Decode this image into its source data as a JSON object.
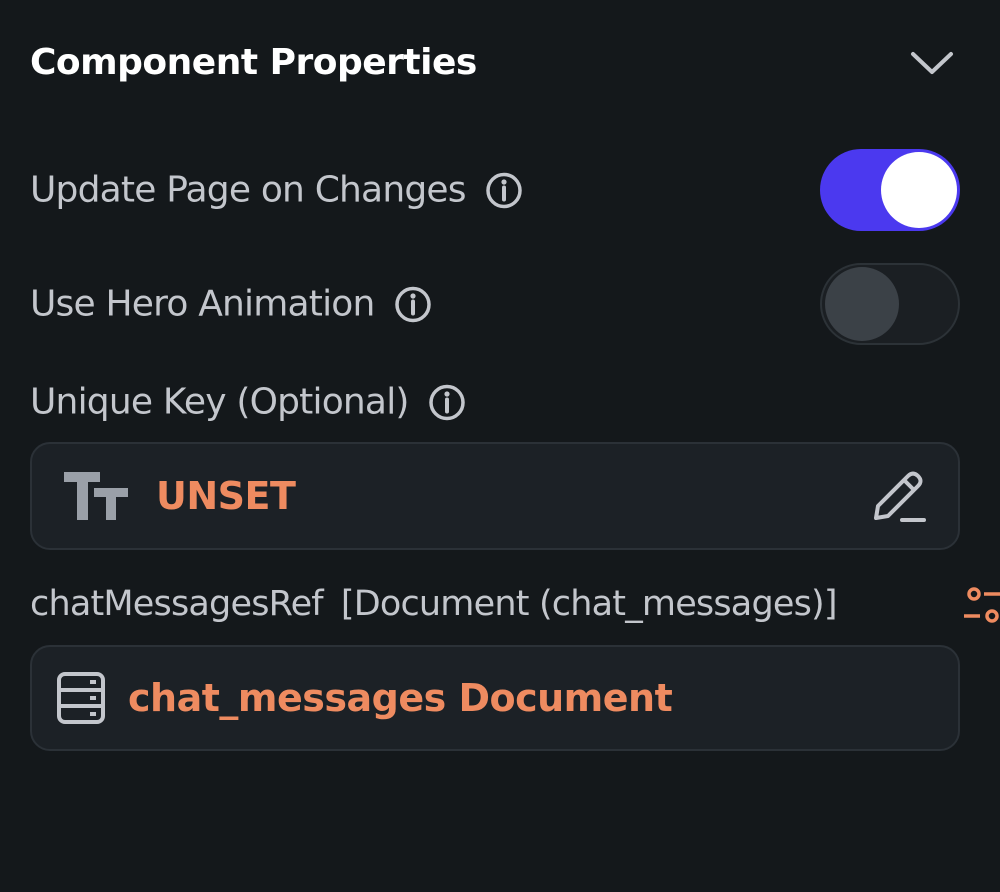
{
  "section": {
    "title": "Component Properties",
    "collapse_icon": "chevron-down-icon"
  },
  "properties": {
    "update_page": {
      "label": "Update Page on Changes",
      "enabled": true,
      "info_icon": "info-icon"
    },
    "hero_animation": {
      "label": "Use Hero Animation",
      "enabled": false,
      "info_icon": "info-icon"
    },
    "unique_key": {
      "label": "Unique Key (Optional)",
      "info_icon": "info-icon",
      "value": "UNSET",
      "type_icon": "text-type-icon",
      "edit_icon": "pencil-icon"
    }
  },
  "parameter": {
    "name": "chatMessagesRef",
    "type": "[Document (chat_messages)]",
    "value": "chat_messages Document",
    "value_icon": "database-icon",
    "config_icon": "settings-sliders-icon"
  },
  "colors": {
    "background": "#14181b",
    "accent": "#4b39ef",
    "value_orange": "#ee8b60",
    "text_secondary": "#c3c6cc",
    "field_bg": "#1c2126"
  }
}
